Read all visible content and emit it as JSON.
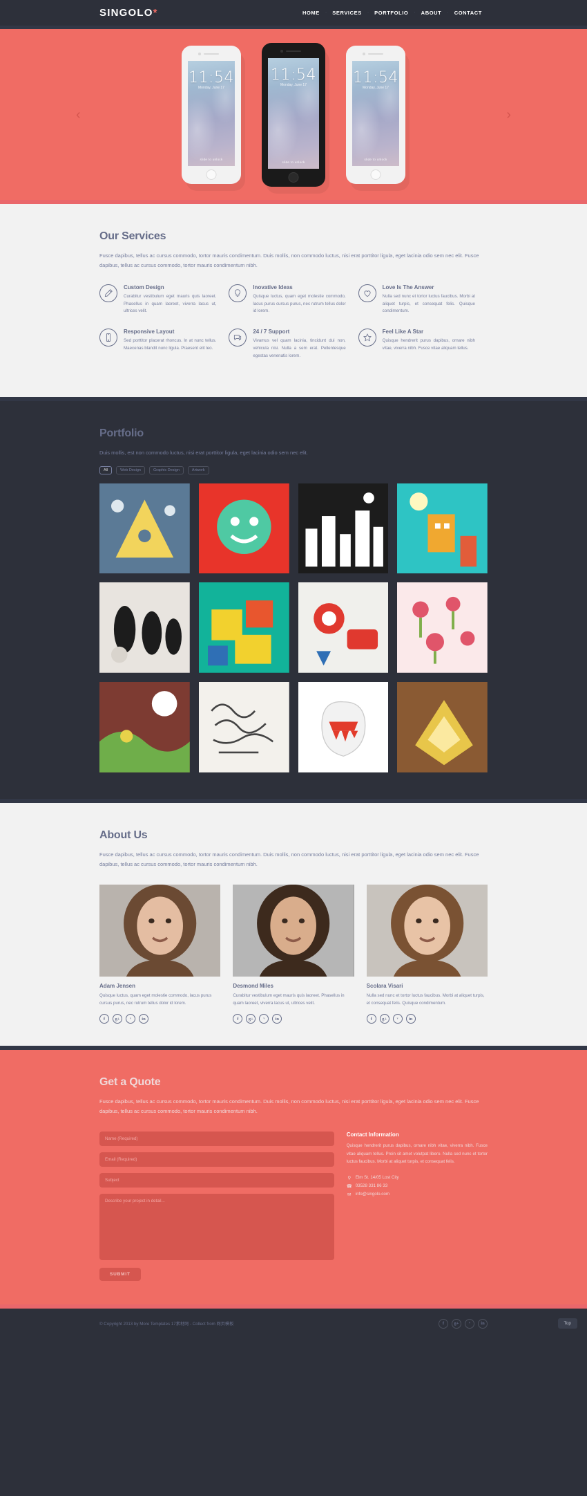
{
  "header": {
    "logo": "SINGOLO",
    "logo_dot": "*",
    "nav": [
      {
        "label": "HOME"
      },
      {
        "label": "SERVICES"
      },
      {
        "label": "PORTFOLIO"
      },
      {
        "label": "ABOUT"
      },
      {
        "label": "CONTACT"
      }
    ],
    "nav_separator": "·"
  },
  "slider": {
    "prev_icon": "‹",
    "next_icon": "›",
    "phones": [
      {
        "variant": "white",
        "time": "11:54",
        "date": "Monday, June 17",
        "unlock": "slide to unlock"
      },
      {
        "variant": "black",
        "time": "11:54",
        "date": "Monday, June 17",
        "unlock": "slide to unlock"
      },
      {
        "variant": "white",
        "time": "11:54",
        "date": "Monday, June 17",
        "unlock": "slide to unlock"
      }
    ]
  },
  "services": {
    "title": "Our Services",
    "subtitle": "Fusce dapibus, tellus ac cursus commodo, tortor mauris condimentum. Duis mollis, non commodo luctus, nisi erat porttitor ligula, eget lacinia odio sem nec elit. Fusce dapibus, tellus ac cursus commodo, tortor mauris condimentum nibh.",
    "items": [
      {
        "icon": "pencil-icon",
        "title": "Custom Design",
        "text": "Curabitur vestibulum eget mauris quis laoreet. Phasellus in quam laoreet, viverra lacus ut, ultrices velit."
      },
      {
        "icon": "lightbulb-icon",
        "title": "Inovative Ideas",
        "text": "Quisque luctus, quam eget molestie commodo, lacus purus cursus purus, nec rutrum tellus dolor id lorem."
      },
      {
        "icon": "heart-icon",
        "title": "Love Is The Answer",
        "text": "Nulla sed nunc et tortor luctus faucibus. Morbi at aliquet turpis, et consequat felis. Quisque condimentum."
      },
      {
        "icon": "phone-icon",
        "title": "Responsive Layout",
        "text": "Sed porttitor placerat rhoncus. In at nunc tellus. Maecenas blandit nunc ligula. Praesent elit leo."
      },
      {
        "icon": "speech-bubble-icon",
        "title": "24 / 7 Support",
        "text": "Vivamus vel quam lacinia, tincidunt dui non, vehicula nisi. Nulla a sem erat. Pellentesque egestas venenatis lorem."
      },
      {
        "icon": "star-icon",
        "title": "Feel Like A Star",
        "text": "Quisque hendrerit purus dapibus, ornare nibh vitae, viverra nibh. Fusce vitae aliquam tellus."
      }
    ]
  },
  "portfolio": {
    "title": "Portfolio",
    "subtitle": "Duis mollis, est non commodo luctus, nisi erat porttitor ligula, eget lacinia odio sem nec elit.",
    "filters": [
      {
        "label": "All",
        "active": true
      },
      {
        "label": "Web Design",
        "active": false
      },
      {
        "label": "Graphic Design",
        "active": false
      },
      {
        "label": "Artwork",
        "active": false
      }
    ],
    "works": [
      {
        "name": "triangle-pyramid-artwork",
        "colors": [
          "#5b7a96",
          "#f2d45c"
        ]
      },
      {
        "name": "green-monster-artwork",
        "colors": [
          "#e8342a",
          "#4fc9a3"
        ]
      },
      {
        "name": "city-sketch-artwork",
        "colors": [
          "#1c1c1c",
          "#ffffff"
        ]
      },
      {
        "name": "robot-city-artwork",
        "colors": [
          "#2ec4c4",
          "#f0a830"
        ]
      },
      {
        "name": "black-creatures-artwork",
        "colors": [
          "#e8e4df",
          "#1c1c1c"
        ]
      },
      {
        "name": "bdk-blocks-artwork",
        "colors": [
          "#12b39a",
          "#f2d12e"
        ]
      },
      {
        "name": "red-robots-artwork",
        "colors": [
          "#f0f0ec",
          "#e0392f"
        ]
      },
      {
        "name": "birds-flowers-artwork",
        "colors": [
          "#fbe9ea",
          "#e0556a"
        ]
      },
      {
        "name": "green-monster-moon-artwork",
        "colors": [
          "#7d3b32",
          "#6fae4a"
        ]
      },
      {
        "name": "handwriting-artwork",
        "colors": [
          "#f3f1ec",
          "#444444"
        ]
      },
      {
        "name": "white-monster-artwork",
        "colors": [
          "#ffffff",
          "#e23b2b"
        ]
      },
      {
        "name": "gold-wrapper-artwork",
        "colors": [
          "#8a5a33",
          "#e8c64a"
        ]
      }
    ]
  },
  "about": {
    "title": "About Us",
    "subtitle": "Fusce dapibus, tellus ac cursus commodo, tortor mauris condimentum. Duis mollis, non commodo luctus, nisi erat porttitor ligula, eget lacinia odio sem nec elit. Fusce dapibus, tellus ac cursus commodo, tortor mauris condimentum nibh.",
    "members": [
      {
        "name": "Adam Jensen",
        "text": "Quisque luctus, quam eget molestie commodo, lacus purus cursus purus, nec rutrum tellus dolor id lorem.",
        "photo": "woman-curly-hair-portrait"
      },
      {
        "name": "Desmond Miles",
        "text": "Curabitur vestibulum eget mauris quis laoreet. Phasellus in quam laoreet, viverra lacus ut, ultrices velit.",
        "photo": "man-smiling-portrait"
      },
      {
        "name": "Scolara Visari",
        "text": "Nulla sed nunc et tortor luctus faucibus. Morbi at aliquet turpis, et consequat felis. Quisque condimentum.",
        "photo": "woman-long-hair-portrait"
      }
    ],
    "socials": [
      {
        "name": "facebook-icon",
        "glyph": "f"
      },
      {
        "name": "google-plus-icon",
        "glyph": "g+"
      },
      {
        "name": "twitter-icon",
        "glyph": "ᵛ"
      },
      {
        "name": "linkedin-icon",
        "glyph": "in"
      }
    ]
  },
  "quote": {
    "title": "Get a Quote",
    "subtitle": "Fusce dapibus, tellus ac cursus commodo, tortor mauris condimentum. Duis mollis, non commodo luctus, nisi erat porttitor ligula, eget lacinia odio sem nec elit. Fusce dapibus, tellus ac cursus commodo, tortor mauris condimentum nibh.",
    "form": {
      "name_placeholder": "Name (Required)",
      "name_value": "",
      "email_placeholder": "Email (Required)",
      "email_value": "",
      "subject_placeholder": "Subject",
      "subject_value": "",
      "message_placeholder": "Describe your project in detail...",
      "message_value": "",
      "submit_label": "SUBMIT"
    },
    "info": {
      "title": "Contact Information",
      "text": "Quisque hendrerit purus dapibus, ornare nibh vitae, viverra nibh. Fusce vitae aliquam tellus. Proin sit amet volutpat libero. Nulla sed nunc et tortor luctus faucibus. Morbi at aliquet turpis, et consequat felis.",
      "address_icon": "location-pin-icon",
      "address": "Elm St. 14/05 Lost City",
      "phone_icon": "phone-handset-icon",
      "phone": "03528 331 86 33",
      "email_icon": "envelope-icon",
      "email": "info@singolo.com"
    }
  },
  "footer": {
    "copyright": "© Copyright 2013 by More Templates 17素材网 - Collect from 网页模板",
    "socials": [
      {
        "name": "facebook-icon",
        "glyph": "f"
      },
      {
        "name": "google-plus-icon",
        "glyph": "g+"
      },
      {
        "name": "twitter-icon",
        "glyph": "ᵛ"
      },
      {
        "name": "linkedin-icon",
        "glyph": "in"
      }
    ],
    "top_label": "Top"
  },
  "colors": {
    "dark": "#2d303a",
    "coral": "#f06c64",
    "light": "#f2f2f2",
    "muted": "#767e9e",
    "heading": "#666d89"
  }
}
